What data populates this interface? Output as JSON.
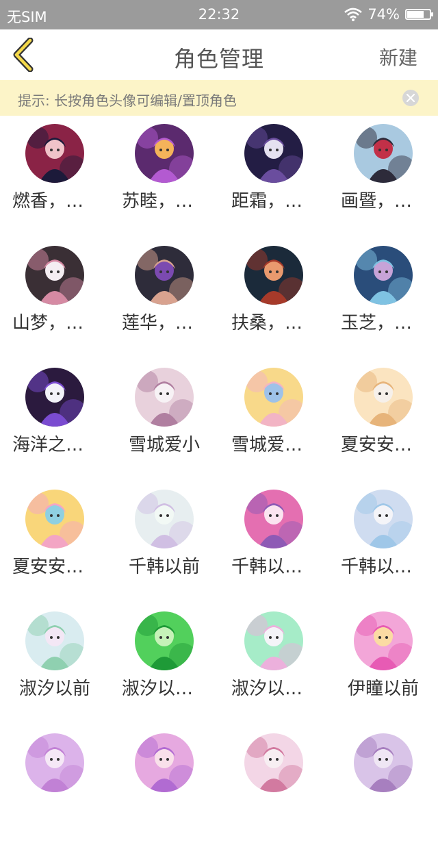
{
  "status_bar": {
    "carrier": "无SIM",
    "time": "22:32",
    "battery": "74%",
    "battery_level": 0.74
  },
  "nav": {
    "title": "角色管理",
    "new_label": "新建"
  },
  "hint": {
    "text": "提示: 长按角色头像可编辑/置顶角色"
  },
  "characters": [
    {
      "name": "燃香，…",
      "colors": [
        "#8a2346",
        "#1c1a3a",
        "#f0c3c9"
      ]
    },
    {
      "name": "苏睦，…",
      "colors": [
        "#5b2a6e",
        "#b35ad1",
        "#f4b35a"
      ]
    },
    {
      "name": "距霜，…",
      "colors": [
        "#231d44",
        "#6a4d9e",
        "#e5e1f0"
      ]
    },
    {
      "name": "画暨，…",
      "colors": [
        "#a9c9e0",
        "#2d2b3a",
        "#c23048"
      ]
    },
    {
      "name": "山梦，…",
      "colors": [
        "#3a2f35",
        "#d58aa3",
        "#f4eef2"
      ]
    },
    {
      "name": "莲华，…",
      "colors": [
        "#2e2c3a",
        "#d8a28f",
        "#7b4ab0"
      ]
    },
    {
      "name": "扶桑，…",
      "colors": [
        "#1b2a3a",
        "#a63a2a",
        "#e99a6e"
      ]
    },
    {
      "name": "玉芝，…",
      "colors": [
        "#2a4d7a",
        "#7fc2e2",
        "#c7a3d8"
      ]
    },
    {
      "name": "海洋之…",
      "colors": [
        "#2b1a3e",
        "#7a4bd0",
        "#f2f2f8"
      ]
    },
    {
      "name": "雪城爱小",
      "colors": [
        "#e8d1dc",
        "#b07fa0",
        "#f7f2f5"
      ]
    },
    {
      "name": "雪城爱…",
      "colors": [
        "#f8d98a",
        "#f2b4c4",
        "#9ec2e8"
      ]
    },
    {
      "name": "夏安安…",
      "colors": [
        "#fbe4c0",
        "#e7b47a",
        "#f6f0ea"
      ]
    },
    {
      "name": "夏安安…",
      "colors": [
        "#f9d67a",
        "#f3a5c4",
        "#8fd0e2"
      ]
    },
    {
      "name": "千韩以前",
      "colors": [
        "#e7eef0",
        "#d0bfe3",
        "#f2f9f5"
      ]
    },
    {
      "name": "千韩以…",
      "colors": [
        "#e46fb1",
        "#8e5ab5",
        "#fbe4f0"
      ]
    },
    {
      "name": "千韩以…",
      "colors": [
        "#cfdcf0",
        "#9fc7e8",
        "#f4f4f8"
      ]
    },
    {
      "name": "淑汐以前",
      "colors": [
        "#d9ecf0",
        "#8fd0b0",
        "#f3e7f5"
      ]
    },
    {
      "name": "淑汐以…",
      "colors": [
        "#52d05c",
        "#1e9a37",
        "#c6f2b8"
      ]
    },
    {
      "name": "淑汐以…",
      "colors": [
        "#a6ecc8",
        "#ecb0dc",
        "#f4f4f8"
      ]
    },
    {
      "name": "伊瞳以前",
      "colors": [
        "#f3a6d8",
        "#e75bb4",
        "#fbdba3"
      ]
    },
    {
      "name": "",
      "colors": [
        "#dcb3ea",
        "#c181d5",
        "#f5e8f6"
      ]
    },
    {
      "name": "",
      "colors": [
        "#e6a9e0",
        "#b16bd2",
        "#f9e0ea"
      ]
    },
    {
      "name": "",
      "colors": [
        "#f3d6e6",
        "#d27aa0",
        "#f7eef2"
      ]
    },
    {
      "name": "",
      "colors": [
        "#d9c4e8",
        "#a77fbf",
        "#efe6f4"
      ]
    }
  ]
}
